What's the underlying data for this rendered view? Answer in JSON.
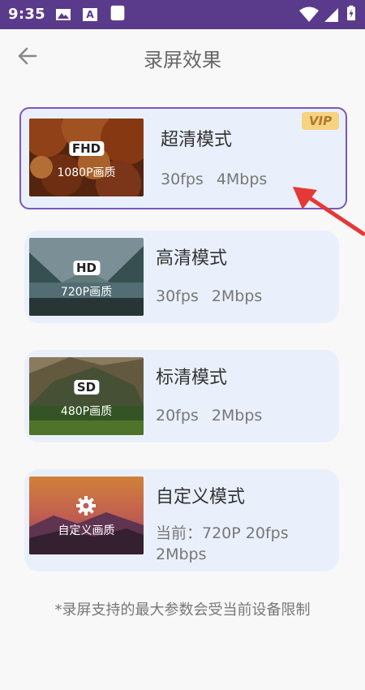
{
  "status_bar": {
    "time": "9:35"
  },
  "header": {
    "title": "录屏效果"
  },
  "modes": [
    {
      "name": "超清模式",
      "badge": "FHD",
      "quality": "1080P画质",
      "fps": "30fps",
      "bitrate": "4Mbps",
      "vip": "VIP",
      "selected": true
    },
    {
      "name": "高清模式",
      "badge": "HD",
      "quality": "720P画质",
      "fps": "30fps",
      "bitrate": "2Mbps"
    },
    {
      "name": "标清模式",
      "badge": "SD",
      "quality": "480P画质",
      "fps": "20fps",
      "bitrate": "2Mbps"
    },
    {
      "name": "自定义模式",
      "quality": "自定义画质",
      "current": "当前：720P  20fps 2Mbps"
    }
  ],
  "footnote": "*录屏支持的最大参数会受当前设备限制",
  "icons": [
    "back-arrow-icon",
    "image-icon",
    "a-icon",
    "square-icon",
    "wifi-icon",
    "signal-icon",
    "battery-icon",
    "gear-icon"
  ],
  "colors": {
    "status_bar": "#5a3a8a",
    "accent": "#7a56c0",
    "card_bg": "#eaf0fb",
    "arrow": "#e53935",
    "vip_bg": "#f6d283"
  }
}
